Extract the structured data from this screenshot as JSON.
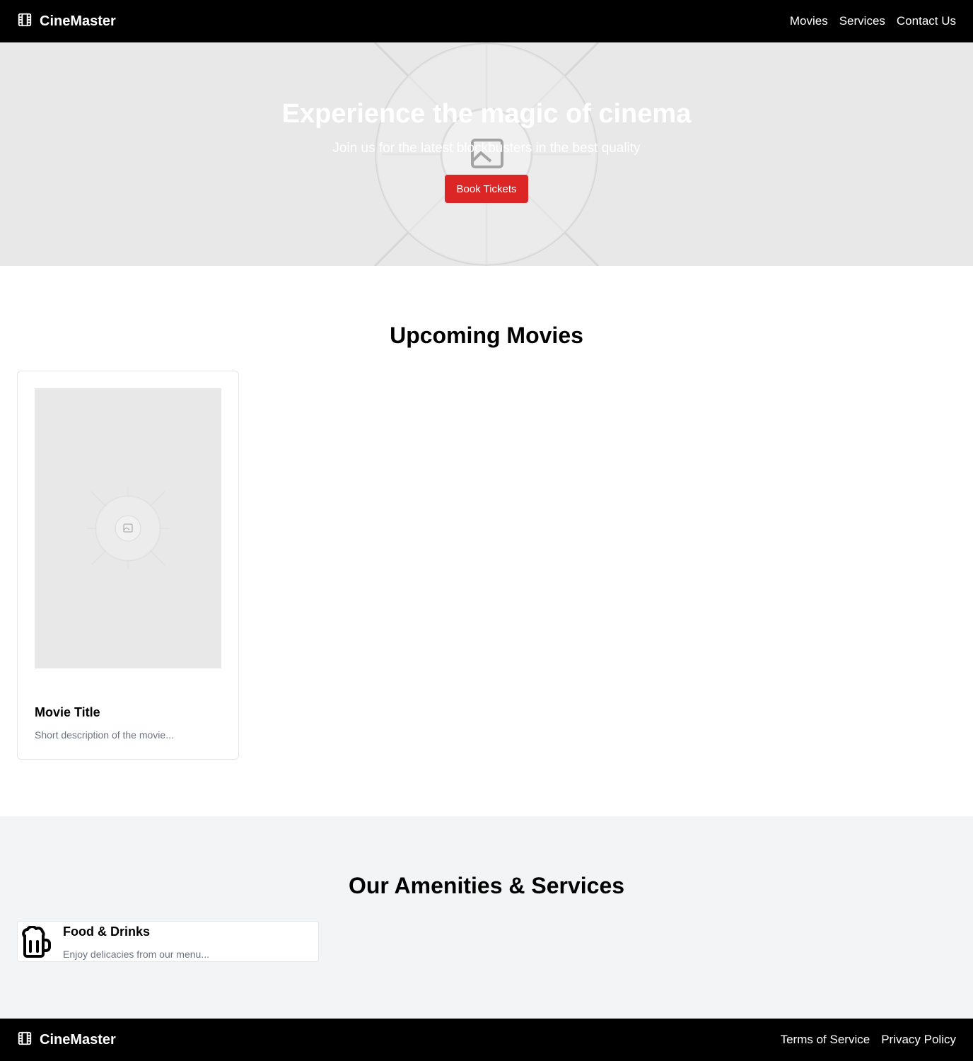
{
  "header": {
    "brand": "CineMaster",
    "brand_icon": "film-icon",
    "nav": [
      "Movies",
      "Services",
      "Contact Us"
    ]
  },
  "hero": {
    "title": "Experience the magic of cinema",
    "subtitle": "Join us for the latest blockbusters in the best quality",
    "button": "Book Tickets",
    "image_icon": "image-placeholder-icon"
  },
  "movies": {
    "heading": "Upcoming Movies",
    "items": [
      {
        "title": "Movie Title",
        "description": "Short description of the movie...",
        "poster_icon": "image-placeholder-icon"
      }
    ]
  },
  "amenities": {
    "heading": "Our Amenities & Services",
    "items": [
      {
        "icon": "beer-mug-icon",
        "title": "Food & Drinks",
        "description": "Enjoy delicacies from our menu..."
      }
    ]
  },
  "footer": {
    "brand": "CineMaster",
    "brand_icon": "film-icon",
    "links": [
      "Terms of Service",
      "Privacy Policy"
    ]
  },
  "colors": {
    "header_bg": "#000000",
    "accent": "#dc2626",
    "placeholder_bg": "#e8e8e8",
    "section_bg": "#f3f4f6",
    "muted_text": "#6b7280"
  }
}
